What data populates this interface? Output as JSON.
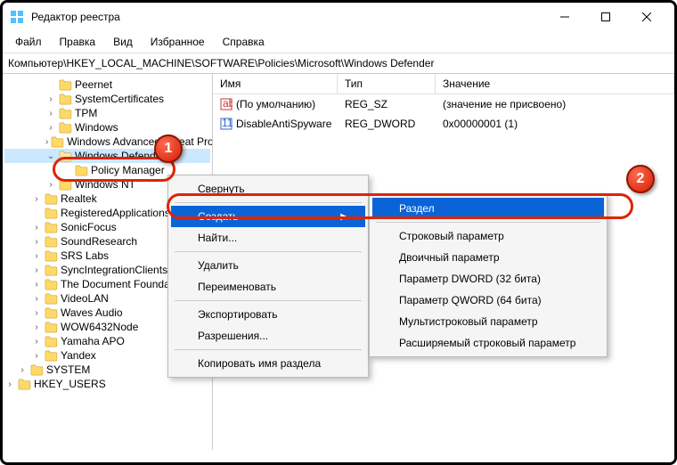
{
  "title": "Редактор реестра",
  "menu": {
    "file": "Файл",
    "edit": "Правка",
    "view": "Вид",
    "fav": "Избранное",
    "help": "Справка"
  },
  "address": "Компьютер\\HKEY_LOCAL_MACHINE\\SOFTWARE\\Policies\\Microsoft\\Windows Defender",
  "columns": {
    "name": "Имя",
    "type": "Тип",
    "value": "Значение"
  },
  "rows": [
    {
      "name": "(По умолчанию)",
      "type": "REG_SZ",
      "value": "(значение не присвоено)",
      "icon": "str"
    },
    {
      "name": "DisableAntiSpyware",
      "type": "REG_DWORD",
      "value": "0x00000001 (1)",
      "icon": "bin"
    }
  ],
  "tree": {
    "items": [
      {
        "lbl": "Peernet",
        "indent": 3,
        "chev": ""
      },
      {
        "lbl": "SystemCertificates",
        "indent": 3,
        "chev": "›"
      },
      {
        "lbl": "TPM",
        "indent": 3,
        "chev": "›"
      },
      {
        "lbl": "Windows",
        "indent": 3,
        "chev": "›"
      },
      {
        "lbl": "Windows Advanced Threat Protection",
        "indent": 3,
        "chev": "›"
      },
      {
        "lbl": "Windows Defender",
        "indent": 3,
        "chev": "⌄",
        "sel": true
      },
      {
        "lbl": "Policy Manager",
        "indent": 3,
        "chev": "",
        "child": true
      },
      {
        "lbl": "Windows NT",
        "indent": 3,
        "chev": "›"
      },
      {
        "lbl": "Realtek",
        "indent": 2,
        "chev": "›"
      },
      {
        "lbl": "RegisteredApplications",
        "indent": 2,
        "chev": ""
      },
      {
        "lbl": "SonicFocus",
        "indent": 2,
        "chev": "›"
      },
      {
        "lbl": "SoundResearch",
        "indent": 2,
        "chev": "›"
      },
      {
        "lbl": "SRS Labs",
        "indent": 2,
        "chev": "›"
      },
      {
        "lbl": "SyncIntegrationClients",
        "indent": 2,
        "chev": "›"
      },
      {
        "lbl": "The Document Foundation",
        "indent": 2,
        "chev": "›"
      },
      {
        "lbl": "VideoLAN",
        "indent": 2,
        "chev": "›"
      },
      {
        "lbl": "Waves Audio",
        "indent": 2,
        "chev": "›"
      },
      {
        "lbl": "WOW6432Node",
        "indent": 2,
        "chev": "›"
      },
      {
        "lbl": "Yamaha APO",
        "indent": 2,
        "chev": "›"
      },
      {
        "lbl": "Yandex",
        "indent": 2,
        "chev": "›"
      },
      {
        "lbl": "SYSTEM",
        "indent": 1,
        "chev": "›"
      },
      {
        "lbl": "HKEY_USERS",
        "indent": 0,
        "chev": "›"
      }
    ]
  },
  "context_main": {
    "collapse": "Свернуть",
    "create": "Создать",
    "find": "Найти...",
    "delete": "Удалить",
    "rename": "Переименовать",
    "export": "Экспортировать",
    "perms": "Разрешения...",
    "copyname": "Копировать имя раздела"
  },
  "context_sub": {
    "key": "Раздел",
    "string": "Строковый параметр",
    "binary": "Двоичный параметр",
    "dword": "Параметр DWORD (32 бита)",
    "qword": "Параметр QWORD (64 бита)",
    "multi": "Мультистроковый параметр",
    "expand": "Расширяемый строковый параметр"
  },
  "markers": {
    "one": "1",
    "two": "2"
  }
}
